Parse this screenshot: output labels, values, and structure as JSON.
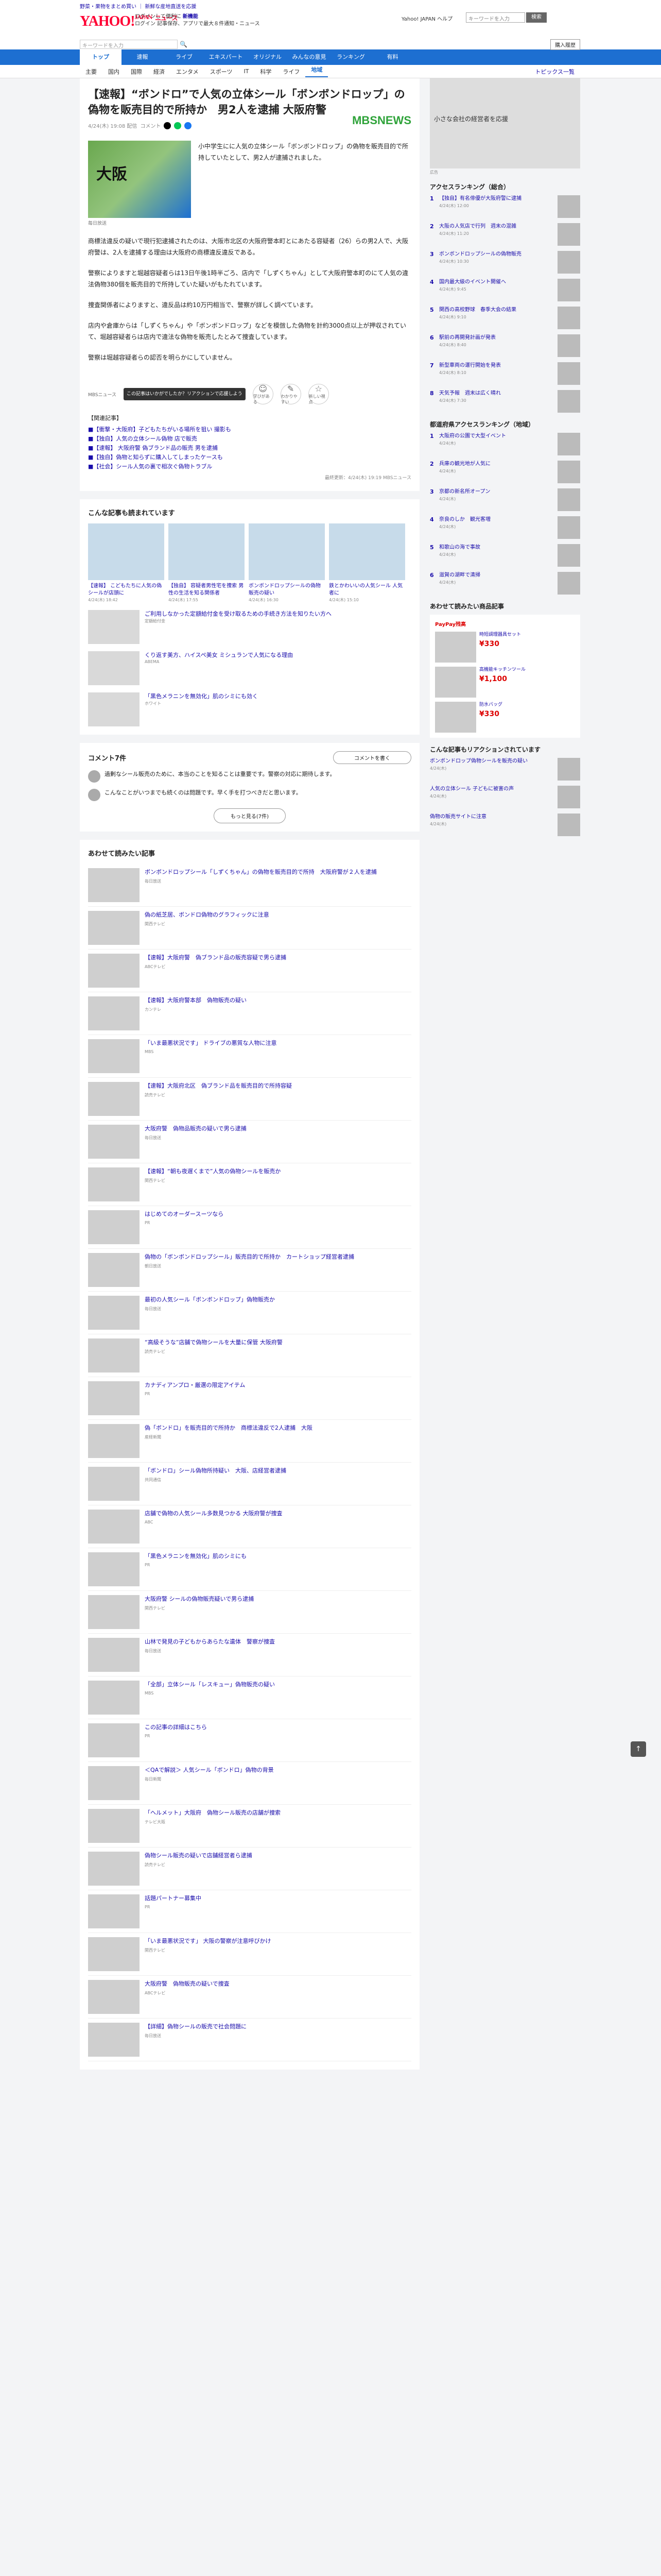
{
  "topbar": {
    "text": "野菜・果物をまとめ買い ｜ 新鮮な産地直送を応援"
  },
  "header": {
    "logo": "YAHOO!",
    "logo_sub": "JAPAN",
    "logo_news": "ニュース",
    "promo_line1": "ログインして便利に",
    "promo_bold": "新機能",
    "promo_line2": "ログイン 記事保存、アプリで最大８件通知・ニュース",
    "right_links": "Yahoo! JAPAN ヘルプ",
    "search_placeholder": "キーワードを入力",
    "search_button": "検索",
    "login": "購入履歴"
  },
  "nav": {
    "items": [
      "トップ",
      "速報",
      "ライブ",
      "エキスパート",
      "オリジナル",
      "みんなの意見",
      "ランキング",
      "有料"
    ],
    "active": 0
  },
  "subnav": {
    "items": [
      "主要",
      "国内",
      "国際",
      "経済",
      "エンタメ",
      "スポーツ",
      "IT",
      "科学",
      "ライフ",
      "地域"
    ],
    "active": 9,
    "topics": "トピックス一覧"
  },
  "article": {
    "title": "【速報】“ボンドロ”で人気の立体シール「ボンボンドロップ」の偽物を販売目的で所持か　男2人を逮捕 大阪府警",
    "date": "4/24(木) 19:08 配信",
    "comments": "コメント",
    "provider": "MBSNEWS",
    "hero_label": "大阪",
    "hero_caption": "毎日放送",
    "lead": "小中学生にに人気の立体シール「ボンボンドロップ」の偽物を販売目的で所持していたとして、男2人が逮捕されました。",
    "para1": "商標法違反の疑いで現行犯逮捕されたのは、大阪市北区の大阪府警本町とにあたる容疑者（26）らの男2人で、大阪府警は、2人を逮捕する理由は大阪府の商標違反違反である。",
    "para2": "警察によりますと堀越容疑者らは13日午後1時半ごろ、店内で「しずくちゃん」として大阪府警本町のにて人気の違法偽物380個を販売目的で所持していた疑いがもたれています。",
    "para3": "捜査関係者によりますと、違反品は約10万円相当で、警察が詳しく調べています。",
    "para4": "店内や倉庫からは「しずくちゃん」や「ボンボンドロップ」などを模倣した偽物を計約3000点以上が押収されていて、堀越容疑者らは店内で違法な偽物を販売したとみて捜査しています。",
    "para5": "警察は堀越容疑者らの認否を明らかにしていません。",
    "feedback_label": "MBSニュース",
    "feedback_tip": "この記事はいかがでしたか？リアクションで応援しよう",
    "reactions": [
      {
        "icon": "☺",
        "label": "学びがある"
      },
      {
        "icon": "✎",
        "label": "わかりやすい"
      },
      {
        "icon": "☆",
        "label": "新しい視点"
      }
    ],
    "related_head": "【関連記事】",
    "related": [
      "■【衝撃・大阪府】子どもたちがいる場所を狙い 撮影も",
      "■【独自】人気の立体シール偽物 店で販売",
      "■【速報】 大阪府警 偽ブランド品の販売 男を逮捕",
      "■【独自】偽物と知らずに購入してしまったケースも",
      "■【社会】シール人気の裏で相次ぐ偽物トラブル"
    ],
    "related_foot": "最終更新：4/24(木) 19:19",
    "related_provider": "MBSニュース"
  },
  "also_read": {
    "heading": "こんな記事も読まれています",
    "items": [
      {
        "title": "【速報】 こどもたちに人気の偽シールが店頭に",
        "time": "4/24(木) 18:42"
      },
      {
        "title": "【独自】 容疑者男性宅を捜索 男性の生活を知る関係者",
        "time": "4/24(木) 17:55"
      },
      {
        "title": "ボンボンドロップシールの偽物 販売の疑い",
        "time": "4/24(木) 16:30"
      },
      {
        "title": "鉄とかわいいの人気シール 人気者に",
        "time": "4/24(木) 15:10"
      }
    ]
  },
  "promos": [
    {
      "title": "ご利用しなかった定額給付金を受け取るための手続き方法を知りたい方へ",
      "sub": "定額給付金"
    },
    {
      "title": "くり返す美方、ハイスペ美女 ミシュランで人気になる理由",
      "sub": "ABEMA"
    },
    {
      "title": "「黒色メラニンを無効化」肌のシミにも効く",
      "sub": "ホワイト"
    }
  ],
  "comments": {
    "heading": "コメント7件",
    "write": "コメントを書く",
    "items": [
      {
        "text": "過剰なシール販売のために、本当のことを知ることは重要です。警察の対応に期待します。"
      },
      {
        "text": "こんなことがいつまでも続くのは問題です。早く手を打つべきだと思います。"
      }
    ],
    "more": "もっと見る(7件)"
  },
  "recommend": {
    "heading": "あわせて読みたい記事",
    "items": [
      {
        "title": "ボンボンドロップシール「しずくちゃん」の偽物を販売目的で所持　大阪府警が２人を逮捕",
        "src": "毎日放送"
      },
      {
        "title": "偽の紙芝居、ボンドロ偽物のグラフィックに注意",
        "src": "関西テレビ"
      },
      {
        "title": "【速報】大阪府警　偽ブランド品の販売容疑で男ら逮捕",
        "src": "ABCテレビ"
      },
      {
        "title": "【速報】大阪府警本部　偽物販売の疑い",
        "src": "カンテレ"
      },
      {
        "title": "「いま最悪状況です」 ドライブの悪質な人物に注意",
        "src": "MBS"
      },
      {
        "title": "【速報】大阪府北区　偽ブランド品を販売目的で所持容疑",
        "src": "読売テレビ"
      },
      {
        "title": "大阪府警　偽物品販売の疑いで男ら逮捕",
        "src": "毎日放送"
      },
      {
        "title": "【速報】“朝も夜遅くまで”人気の偽物シールを販売か",
        "src": "関西テレビ"
      },
      {
        "title": "はじめてのオーダースーツなら",
        "src": "PR"
      },
      {
        "title": "偽物の「ボンボンドロップシール」販売目的で所持か　カートショップ経営者逮捕",
        "src": "朝日放送"
      },
      {
        "title": "最初の人気シール「ボンボンドロップ」偽物販売か",
        "src": "毎日放送"
      },
      {
        "title": "“高級そうな”店舗で偽物シールを大量に保管 大阪府警",
        "src": "読売テレビ"
      },
      {
        "title": "カナディアンプロ・厳選の限定アイテム",
        "src": "PR"
      },
      {
        "title": "偽「ボンドロ」を販売目的で所持か　商標法違反で2人逮捕　大阪",
        "src": "産経新聞"
      },
      {
        "title": "「ボンドロ」シール偽物所持疑い　大阪、店経営者逮捕",
        "src": "共同通信"
      },
      {
        "title": "店舗で偽物の人気シール多数見つかる 大阪府警が捜査",
        "src": "ABC"
      },
      {
        "title": "「黒色メラニンを無効化」肌のシミにも",
        "src": "PR"
      },
      {
        "title": "大阪府警 シールの偽物販売疑いで男ら逮捕",
        "src": "関西テレビ"
      },
      {
        "title": "山林で発見の子どもからあらたな遺体　警察が捜査",
        "src": "毎日放送"
      },
      {
        "title": "「全部」立体シール「レスキュー」偽物販売の疑い",
        "src": "MBS"
      },
      {
        "title": "この記事の詳細はこちら",
        "src": "PR"
      },
      {
        "title": "＜QAで解説＞ 人気シール「ボンドロ」偽物の背景",
        "src": "毎日新聞"
      },
      {
        "title": "「ヘルメット」大阪府　偽物シール販売の店舗が捜索",
        "src": "テレビ大阪"
      },
      {
        "title": "偽物シール販売の疑いで店舗経営者ら逮捕",
        "src": "読売テレビ"
      },
      {
        "title": "話題パートナー募集中",
        "src": "PR"
      },
      {
        "title": "「いま最悪状況です」 大阪の警察が注意呼びかけ",
        "src": "関西テレビ"
      },
      {
        "title": "大阪府警　偽物販売の疑いで捜査",
        "src": "ABCテレビ"
      },
      {
        "title": "【詳細】偽物シールの販売で社会問題に",
        "src": "毎日放送"
      }
    ]
  },
  "side": {
    "ad_label": "広告",
    "ad_caption": "小さな会社の経営者を応援",
    "access_heading": "アクセスランキング（総合）",
    "ranking": [
      {
        "n": "1",
        "title": "【独自】有名俳優が大阪府警に逮捕",
        "time": "4/24(木) 12:00"
      },
      {
        "n": "2",
        "title": "大阪の人気店で行列　週末の混雑",
        "time": "4/24(木) 11:20"
      },
      {
        "n": "3",
        "title": "ボンボンドロップシールの偽物販売",
        "time": "4/24(木) 10:30"
      },
      {
        "n": "4",
        "title": "国内最大級のイベント開催へ",
        "time": "4/24(木) 9:45"
      },
      {
        "n": "5",
        "title": "関西の高校野球　春季大会の結果",
        "time": "4/24(木) 9:10"
      },
      {
        "n": "6",
        "title": "駅前の再開発計画が発表",
        "time": "4/24(木) 8:40"
      },
      {
        "n": "7",
        "title": "新型車両の運行開始を発表",
        "time": "4/24(木) 8:10"
      },
      {
        "n": "8",
        "title": "天気予報　週末は広く晴れ",
        "time": "4/24(木) 7:30"
      }
    ],
    "local_heading": "都道府県アクセスランキング（地域）",
    "local_ranking": [
      {
        "n": "1",
        "title": "大阪府の公園で大型イベント",
        "time": "4/24(木)"
      },
      {
        "n": "2",
        "title": "兵庫の観光地が人気に",
        "time": "4/24(木)"
      },
      {
        "n": "3",
        "title": "京都の新名所オープン",
        "time": "4/24(木)"
      },
      {
        "n": "4",
        "title": "奈良のしか　観光客増",
        "time": "4/24(木)"
      },
      {
        "n": "5",
        "title": "和歌山の海で事故",
        "time": "4/24(木)"
      },
      {
        "n": "6",
        "title": "滋賀の湖畔で清掃",
        "time": "4/24(木)"
      }
    ],
    "pay_heading": "あわせて読みたい商品記事",
    "pay_label": "PayPay残高",
    "products": [
      {
        "title": "時短調理器具セット",
        "price": "¥330"
      },
      {
        "title": "高機能キッチンツール",
        "price": "¥1,100"
      },
      {
        "title": "防水バッグ",
        "price": "¥330"
      }
    ],
    "reaction_heading": "こんな記事もリアクションされています",
    "reaction_items": [
      {
        "title": "ボンボンドロップ偽物シールを販売の疑い",
        "time": "4/24(木)"
      },
      {
        "title": "人気の立体シール 子どもに被害の声",
        "time": "4/24(木)"
      },
      {
        "title": "偽物の販売サイトに注意",
        "time": "4/24(木)"
      }
    ]
  }
}
